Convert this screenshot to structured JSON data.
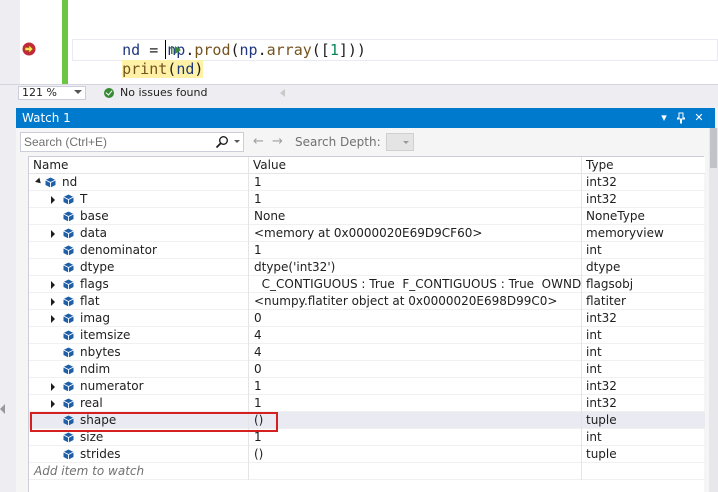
{
  "editor": {
    "line1": {
      "var": "nd",
      "eq": " = ",
      "mod": "np",
      "dot1": ".",
      "fn1": "prod",
      "p1": "(",
      "mod2": "np",
      "dot2": ".",
      "fn2": "array",
      "p2": "([",
      "num": "1",
      "p3": "]))"
    },
    "line2": {
      "fn": "print",
      "p1": "(",
      "var": "nd",
      "p2": ")"
    }
  },
  "status": {
    "zoom": "121 %",
    "issues": "No issues found"
  },
  "watch": {
    "title": "Watch 1",
    "search_placeholder": "Search (Ctrl+E)",
    "back_arrow": "←",
    "forward_arrow": "→",
    "depth_label": "Search Depth:",
    "columns": {
      "name": "Name",
      "value": "Value",
      "type": "Type"
    },
    "rows": [
      {
        "name": "nd",
        "value": "1",
        "type": "int32",
        "level": 0,
        "expander": "open"
      },
      {
        "name": "T",
        "value": "1",
        "type": "int32",
        "level": 1,
        "expander": "closed"
      },
      {
        "name": "base",
        "value": "None",
        "type": "NoneType",
        "level": 1,
        "expander": "none"
      },
      {
        "name": "data",
        "value": "<memory at 0x0000020E69D9CF60>",
        "type": "memoryview",
        "level": 1,
        "expander": "closed"
      },
      {
        "name": "denominator",
        "value": "1",
        "type": "int",
        "level": 1,
        "expander": "none"
      },
      {
        "name": "dtype",
        "value": "dtype('int32')",
        "type": "dtype",
        "level": 1,
        "expander": "none"
      },
      {
        "name": "flags",
        "value": "  C_CONTIGUOUS : True  F_CONTIGUOUS : True  OWNDATA ...",
        "type": "flagsobj",
        "level": 1,
        "expander": "closed"
      },
      {
        "name": "flat",
        "value": "<numpy.flatiter object at 0x0000020E698D99C0>",
        "type": "flatiter",
        "level": 1,
        "expander": "closed"
      },
      {
        "name": "imag",
        "value": "0",
        "type": "int32",
        "level": 1,
        "expander": "closed"
      },
      {
        "name": "itemsize",
        "value": "4",
        "type": "int",
        "level": 1,
        "expander": "none"
      },
      {
        "name": "nbytes",
        "value": "4",
        "type": "int",
        "level": 1,
        "expander": "none"
      },
      {
        "name": "ndim",
        "value": "0",
        "type": "int",
        "level": 1,
        "expander": "none"
      },
      {
        "name": "numerator",
        "value": "1",
        "type": "int32",
        "level": 1,
        "expander": "closed"
      },
      {
        "name": "real",
        "value": "1",
        "type": "int32",
        "level": 1,
        "expander": "closed"
      },
      {
        "name": "shape",
        "value": "()",
        "type": "tuple",
        "level": 1,
        "expander": "none",
        "selected": true
      },
      {
        "name": "size",
        "value": "1",
        "type": "int",
        "level": 1,
        "expander": "none"
      },
      {
        "name": "strides",
        "value": "()",
        "type": "tuple",
        "level": 1,
        "expander": "none"
      }
    ],
    "add_item": "Add item to watch"
  },
  "colors": {
    "accent": "#007acc",
    "highlight_box": "#d42020",
    "change_bar": "#6cc644",
    "breakpoint": "#c5283d",
    "cube": "#1e5fa8"
  },
  "icons": {
    "breakpoint": "breakpoint-arrow-icon",
    "run": "run-to-cursor-icon",
    "search": "search-icon",
    "ok": "check-circle-icon",
    "member": "object-member-icon"
  }
}
